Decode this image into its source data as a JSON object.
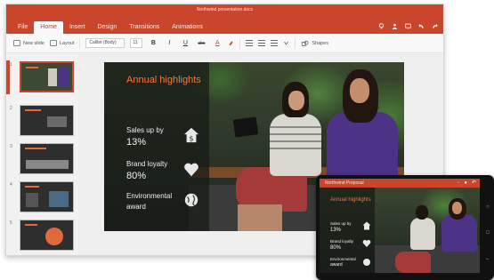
{
  "app": {
    "document_title": "Northwind presentation.docx",
    "tabs": [
      "File",
      "Home",
      "Insert",
      "Design",
      "Transitions",
      "Animations"
    ],
    "active_tab": "Home"
  },
  "ribbon": {
    "new_slide": "New slide",
    "layout": "Layout",
    "font": "Calibri (Body)",
    "size": "11",
    "bold": "B",
    "italic": "I",
    "underline": "U",
    "strike": "abc",
    "font_color": "A",
    "shapes": "Shapes"
  },
  "thumbnails": [
    {
      "number": "1"
    },
    {
      "number": "2"
    },
    {
      "number": "3"
    },
    {
      "number": "4"
    },
    {
      "number": "5"
    }
  ],
  "slide": {
    "title": "Annual highlights",
    "stats": [
      {
        "label": "Sales up by",
        "value": "13%",
        "icon": "dollar-icon"
      },
      {
        "label": "Brand loyalty",
        "value": "80%",
        "icon": "heart-icon"
      },
      {
        "label": "Environmental",
        "value": "award",
        "icon": "globe-icon"
      }
    ]
  },
  "phone": {
    "title": "Northwind Proposal",
    "slide_title": "Annual highlights",
    "stats": [
      {
        "label": "Sales up by",
        "value": "13%"
      },
      {
        "label": "Brand loyalty",
        "value": "80%"
      },
      {
        "label": "Environmental",
        "value": "award"
      }
    ]
  },
  "colors": {
    "accent": "#c9452b",
    "title_orange": "#f07a3e"
  }
}
